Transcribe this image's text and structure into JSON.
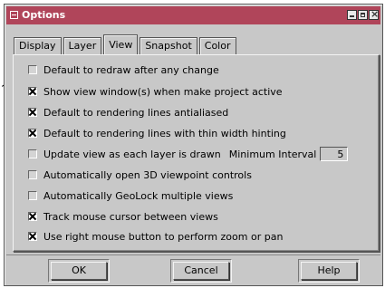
{
  "window": {
    "title": "Options"
  },
  "tabs": [
    {
      "label": "Display",
      "active": false
    },
    {
      "label": "Layer",
      "active": false
    },
    {
      "label": "View",
      "active": true
    },
    {
      "label": "Snapshot",
      "active": false
    },
    {
      "label": "Color",
      "active": false
    }
  ],
  "options": [
    {
      "label": "Default to redraw after any change",
      "checked": false
    },
    {
      "label": "Show view window(s) when make project active",
      "checked": true
    },
    {
      "label": "Default to rendering lines antialiased",
      "checked": true
    },
    {
      "label": "Default to rendering lines with thin width hinting",
      "checked": true
    },
    {
      "label": "Update view as each layer is drawn",
      "checked": false
    },
    {
      "label": "Automatically open 3D viewpoint controls",
      "checked": false
    },
    {
      "label": "Automatically GeoLock multiple views",
      "checked": false
    },
    {
      "label": "Track mouse cursor between views",
      "checked": true
    },
    {
      "label": "Use right mouse button to perform zoom or pan",
      "checked": true
    }
  ],
  "interval": {
    "label": "Minimum Interval",
    "value": "5"
  },
  "buttons": {
    "ok": "OK",
    "cancel": "Cancel",
    "help": "Help"
  },
  "colors": {
    "titlebar": "#b0455a",
    "dialog_bg": "#c8c8c8"
  }
}
